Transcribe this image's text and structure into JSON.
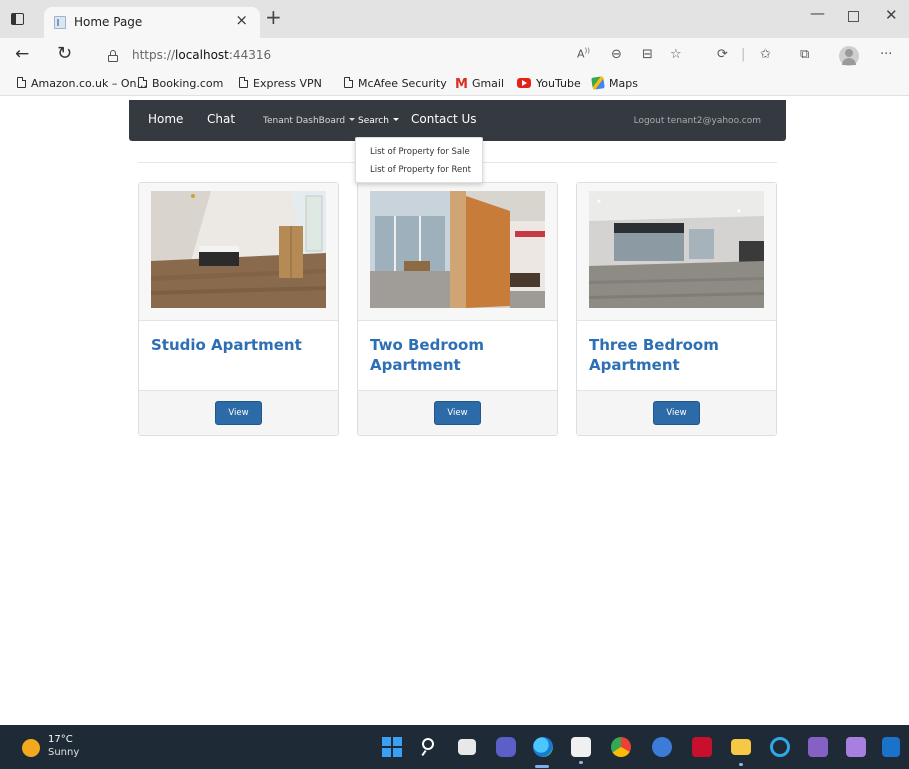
{
  "browser": {
    "tab_title": "Home Page",
    "url_prefix": "https://",
    "url_host": "localhost",
    "url_port": ":44316",
    "favorites": [
      {
        "label": "Amazon.co.uk – On...",
        "icon": "page-icon"
      },
      {
        "label": "Booking.com",
        "icon": "page-icon"
      },
      {
        "label": "Express VPN",
        "icon": "page-icon"
      },
      {
        "label": "McAfee Security",
        "icon": "page-icon"
      },
      {
        "label": "Gmail",
        "icon": "gmail-icon"
      },
      {
        "label": "YouTube",
        "icon": "youtube-icon"
      },
      {
        "label": "Maps",
        "icon": "maps-icon"
      }
    ]
  },
  "navbar": {
    "home": "Home",
    "chat": "Chat",
    "tenant_dashboard": "Tenant DashBoard",
    "search": "Search",
    "contact": "Contact Us",
    "logout": "Logout tenant2@yahoo.com",
    "background": "#343a40"
  },
  "search_dropdown": {
    "items": [
      "List of Property for Sale",
      "List of Property for Rent"
    ]
  },
  "properties": [
    {
      "title": "Studio Apartment",
      "button": "View"
    },
    {
      "title": "Two Bedroom Apartment",
      "button": "View"
    },
    {
      "title": "Three Bedroom Apartment",
      "button": "View"
    }
  ],
  "colors": {
    "link_blue": "#2c6fb4",
    "button_blue": "#2d6ba8"
  },
  "taskbar": {
    "temperature": "17°C",
    "condition": "Sunny"
  }
}
